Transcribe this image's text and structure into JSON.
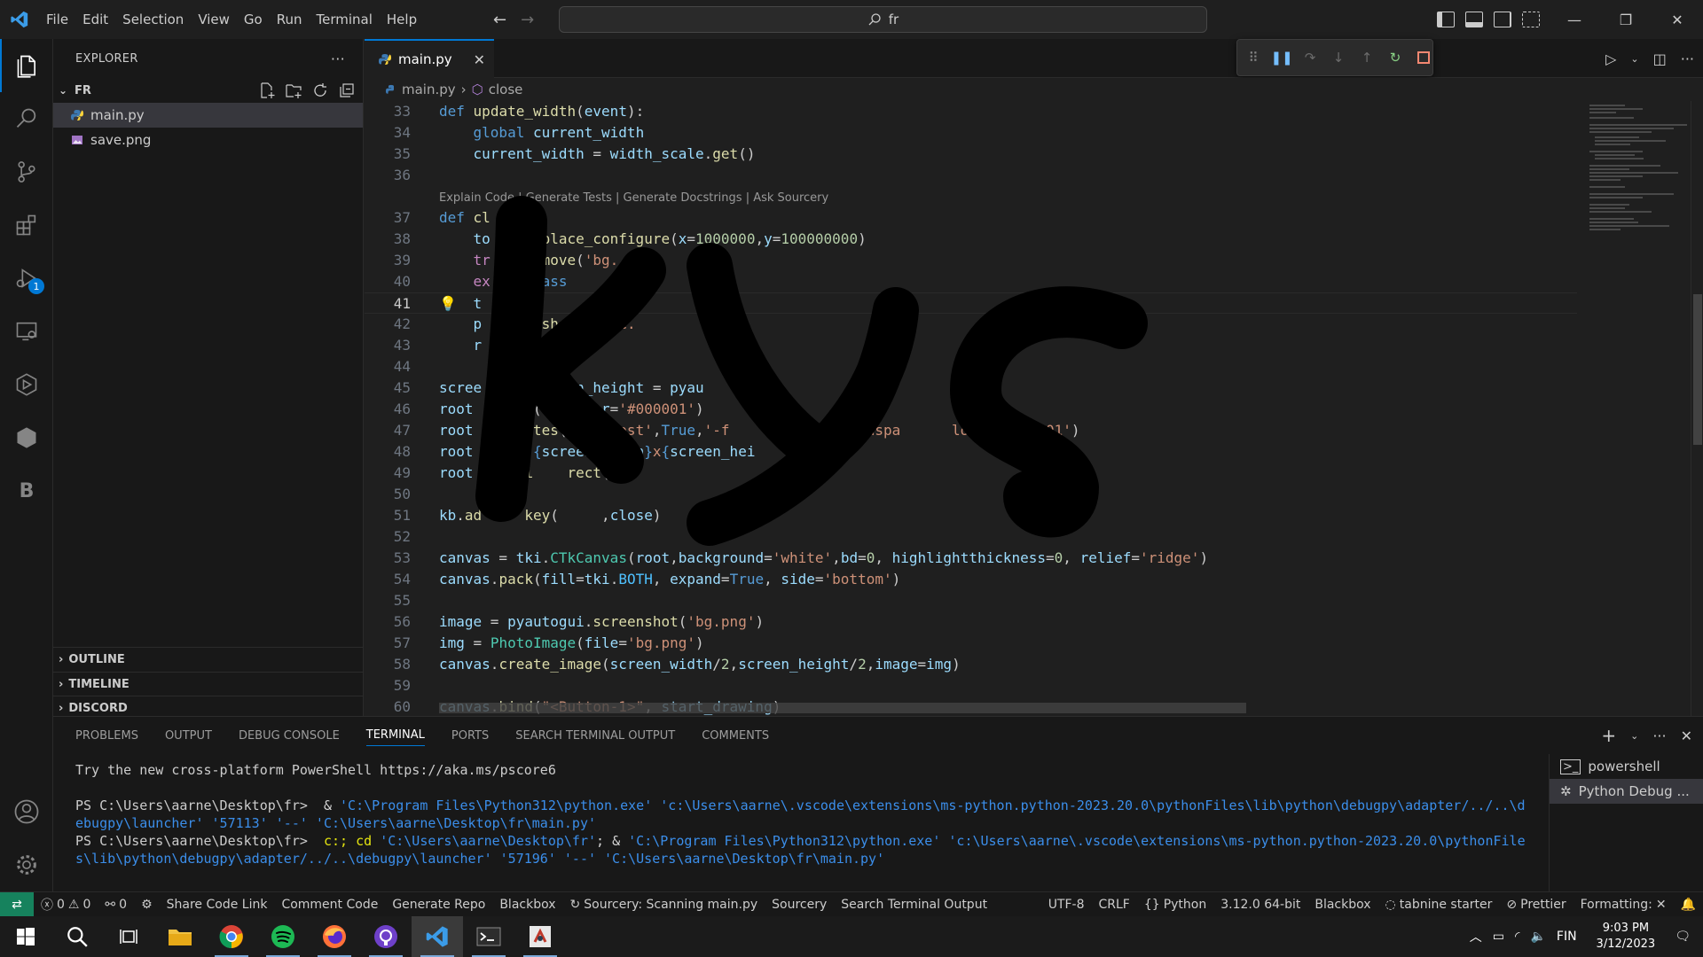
{
  "titlebar": {
    "menu": [
      "File",
      "Edit",
      "Selection",
      "View",
      "Go",
      "Run",
      "Terminal",
      "Help"
    ],
    "search_text": "fr",
    "logo": "vscode-logo"
  },
  "sidebar": {
    "title": "EXPLORER",
    "folder": "FR",
    "files": [
      {
        "name": "main.py",
        "icon": "python-file-icon"
      },
      {
        "name": "save.png",
        "icon": "image-file-icon"
      }
    ],
    "sections": [
      "OUTLINE",
      "TIMELINE",
      "DISCORD"
    ]
  },
  "activity": {
    "debug_badge": "1"
  },
  "editor": {
    "tab_label": "main.py",
    "breadcrumb": {
      "file": "main.py",
      "symbol": "close"
    },
    "codelens": "Explain Code | Generate Tests | Generate Docstrings | Ask Sourcery",
    "lines": [
      {
        "n": "33",
        "text": "def update_width(event):"
      },
      {
        "n": "34",
        "text": "    global current_width"
      },
      {
        "n": "35",
        "text": "    current_width = width_scale.get()"
      },
      {
        "n": "36",
        "text": ""
      },
      {
        "n": "37",
        "text": "def cl   :"
      },
      {
        "n": "38",
        "text": "    to   me.place_configure(x=1000000,y=100000000)"
      },
      {
        "n": "39",
        "text": "    tr   .remove('bg.  g')"
      },
      {
        "n": "40",
        "text": "    ex   : pass"
      },
      {
        "n": "41",
        "text": "    t    o(0"
      },
      {
        "n": "42",
        "text": "    p      nshot('save."
      },
      {
        "n": "43",
        "text": "    r      y()"
      },
      {
        "n": "44",
        "text": ""
      },
      {
        "n": "45",
        "text": "scree    , screen_height = pyau    size("
      },
      {
        "n": "46",
        "text": "root      k(fg_color='#000001')"
      },
      {
        "n": "47",
        "text": "root      utes('-topmost',True,'-f      rue, '-transpa      lor','#000001')"
      },
      {
        "n": "48",
        "text": "root      \"{screen_width}x{screen_hei"
      },
      {
        "n": "49",
        "text": "root     ri    rect(1)"
      },
      {
        "n": "50",
        "text": ""
      },
      {
        "n": "51",
        "text": "kb.ad     key(     ,close)"
      },
      {
        "n": "52",
        "text": ""
      },
      {
        "n": "53",
        "text": "canvas = tki.CTkCanvas(root,background='white',bd=0, highlightthickness=0, relief='ridge')"
      },
      {
        "n": "54",
        "text": "canvas.pack(fill=tki.BOTH, expand=True, side='bottom')"
      },
      {
        "n": "55",
        "text": ""
      },
      {
        "n": "56",
        "text": "image = pyautogui.screenshot('bg.png')"
      },
      {
        "n": "57",
        "text": "img = PhotoImage(file='bg.png')"
      },
      {
        "n": "58",
        "text": "canvas.create_image(screen_width/2,screen_height/2,image=img)"
      },
      {
        "n": "59",
        "text": ""
      },
      {
        "n": "60",
        "text": "canvas.bind(\"<Button-1>\", start_drawing)"
      }
    ]
  },
  "panel": {
    "tabs": [
      "PROBLEMS",
      "OUTPUT",
      "DEBUG CONSOLE",
      "TERMINAL",
      "PORTS",
      "SEARCH TERMINAL OUTPUT",
      "COMMENTS"
    ],
    "active_tab": "TERMINAL",
    "terminal": {
      "line1": "Try the new cross-platform PowerShell https://aka.ms/pscore6",
      "line2_prompt": "PS C:\\Users\\aarne\\Desktop\\fr> ",
      "line2_op": " & ",
      "line2_rest": "'C:\\Program Files\\Python312\\python.exe' 'c:\\Users\\aarne\\.vscode\\extensions\\ms-python.python-2023.20.0\\pythonFiles\\lib\\python\\debugpy\\adapter/../..\\d",
      "line3": "ebugpy\\launcher' '57113' '--' 'C:\\Users\\aarne\\Desktop\\fr\\main.py'",
      "line4_prompt": "PS C:\\Users\\aarne\\Desktop\\fr> ",
      "line4_cmd": " c:; cd ",
      "line4_path": "'C:\\Users\\aarne\\Desktop\\fr'",
      "line4_op": "; & ",
      "line4_rest": "'C:\\Program Files\\Python312\\python.exe' 'c:\\Users\\aarne\\.vscode\\extensions\\ms-python.python-2023.20.0\\pythonFile",
      "line5": "s\\lib\\python\\debugpy\\adapter/../..\\debugpy\\launcher' '57196' '--' 'C:\\Users\\aarne\\Desktop\\fr\\main.py'"
    },
    "terminals": [
      "powershell",
      "Python Debug ..."
    ]
  },
  "statusbar": {
    "errors": "0",
    "warnings": "0",
    "ports": "0",
    "items": [
      "Share Code Link",
      "Comment Code",
      "Generate Repo",
      "Blackbox",
      "Sourcery: Scanning main.py",
      "Sourcery",
      "Search Terminal Output"
    ],
    "right": [
      "UTF-8",
      "CRLF",
      "Python",
      "3.12.0 64-bit",
      "Blackbox",
      "tabnine starter",
      "Prettier",
      "Formatting:"
    ]
  },
  "taskbar": {
    "language": "FIN",
    "time": "9:03 PM",
    "date": "3/12/2023"
  },
  "colors": {
    "accent": "#0078d4",
    "remote": "#16825d",
    "editor_bg": "#1f1f1f",
    "sidebar_bg": "#181818"
  }
}
